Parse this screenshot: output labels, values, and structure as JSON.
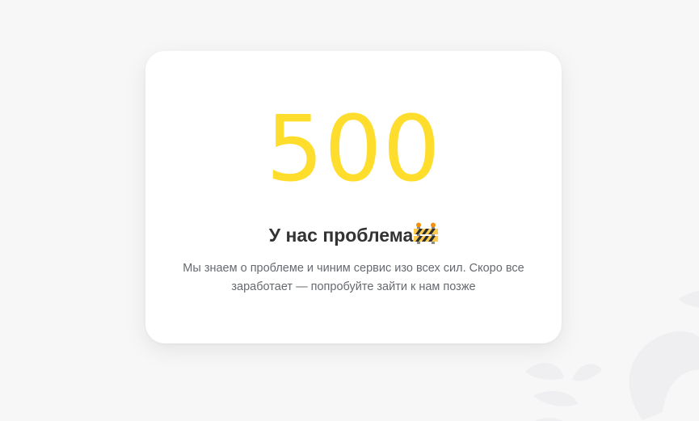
{
  "error": {
    "code": "500",
    "title": "У нас проблема",
    "title_icon": "construction-barrier-icon",
    "description": "Мы знаем о проблеме и чиним сервис изо всех сил. Скоро все заработает — попробуйте зайти к нам позже"
  },
  "colors": {
    "accent": "#ffdd2d",
    "background": "#f7f7f8",
    "card": "#ffffff",
    "title": "#333333",
    "text": "#666a70"
  }
}
